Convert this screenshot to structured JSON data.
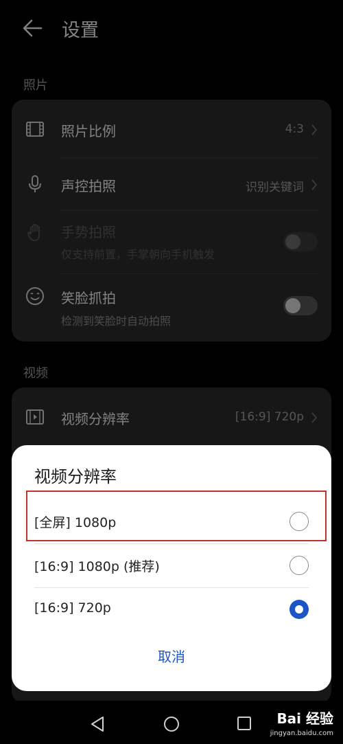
{
  "header": {
    "title": "设置",
    "back_icon": "back-arrow-icon"
  },
  "photo_section": {
    "label": "照片",
    "items": [
      {
        "icon": "aspect-ratio-icon",
        "label": "照片比例",
        "value": "4:3"
      },
      {
        "icon": "microphone-icon",
        "label": "声控拍照",
        "value": "识别关键词"
      },
      {
        "icon": "hand-gesture-icon",
        "label": "手势拍照",
        "sub": "仅支持前置，手掌朝向手机触发",
        "toggle": false,
        "disabled": true
      },
      {
        "icon": "smile-icon",
        "label": "笑脸抓拍",
        "sub": "检测到笑脸时自动拍照",
        "toggle": false
      }
    ]
  },
  "video_section": {
    "label": "视频",
    "items": [
      {
        "icon": "video-resolution-icon",
        "label": "视频分辨率",
        "value": "[16:9] 720p"
      }
    ]
  },
  "dialog": {
    "title": "视频分辨率",
    "options": [
      {
        "label": "[全屏] 1080p",
        "selected": false,
        "highlighted": true
      },
      {
        "label": "[16:9] 1080p (推荐)",
        "selected": false
      },
      {
        "label": "[16:9] 720p",
        "selected": true
      }
    ],
    "cancel_label": "取消",
    "accent_color": "#1a56c6",
    "highlight_color": "#c0332c"
  },
  "navbar": {
    "back": "nav-back-icon",
    "home": "nav-home-icon",
    "recents": "nav-recents-icon"
  },
  "watermark": {
    "text": "Bai 经验",
    "sub": "jingyan.baidu.com"
  }
}
